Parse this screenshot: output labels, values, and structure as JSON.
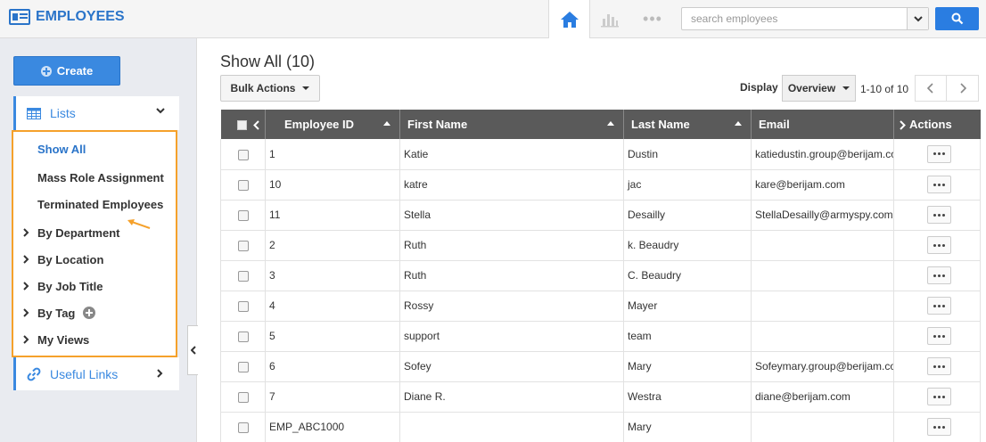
{
  "app": {
    "title": "EMPLOYEES"
  },
  "search": {
    "placeholder": "search employees"
  },
  "sidebar": {
    "create_label": "Create",
    "lists_label": "Lists",
    "items": [
      {
        "label": "Show All",
        "active": true
      },
      {
        "label": "Mass Role Assignment"
      },
      {
        "label": "Terminated Employees"
      },
      {
        "label": "By Department",
        "expandable": true
      },
      {
        "label": "By Location",
        "expandable": true
      },
      {
        "label": "By Job Title",
        "expandable": true
      },
      {
        "label": "By Tag",
        "expandable": true
      },
      {
        "label": "My Views",
        "expandable": true
      }
    ],
    "useful_links_label": "Useful Links"
  },
  "main": {
    "title": "Show All (10)",
    "bulk_actions_label": "Bulk Actions",
    "display_label": "Display",
    "display_value": "Overview",
    "pager_text": "1-10 of 10"
  },
  "table": {
    "headers": [
      "Employee ID",
      "First Name",
      "Last Name",
      "Email",
      "Actions"
    ],
    "rows": [
      [
        "1",
        "Katie",
        "Dustin",
        "katiedustin.group@berijam.com"
      ],
      [
        "10",
        "katre",
        "jac",
        "kare@berijam.com"
      ],
      [
        "11",
        "Stella",
        "Desailly",
        "StellaDesailly@armyspy.com"
      ],
      [
        "2",
        "Ruth",
        "k. Beaudry",
        ""
      ],
      [
        "3",
        "Ruth",
        "C. Beaudry",
        ""
      ],
      [
        "4",
        "Rossy",
        "Mayer",
        ""
      ],
      [
        "5",
        "support",
        "team",
        ""
      ],
      [
        "6",
        "Sofey",
        "Mary",
        "Sofeymary.group@berijam.com"
      ],
      [
        "7",
        "Diane R.",
        "Westra",
        "diane@berijam.com"
      ],
      [
        "EMP_ABC1000",
        "",
        "Mary",
        ""
      ]
    ]
  },
  "colors": {
    "accent": "#2a74c9",
    "highlight_border": "#f5a12b",
    "header_bg": "#5a5a5a"
  }
}
